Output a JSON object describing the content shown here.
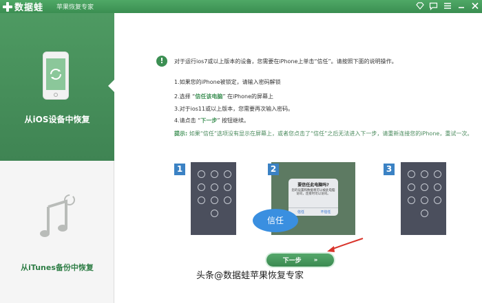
{
  "titlebar": {
    "app_name": "数据蛙",
    "subtitle": "苹果恢复专家",
    "icons": [
      "diamond-icon",
      "chat-icon",
      "menu-icon",
      "minimize-icon",
      "close-icon"
    ]
  },
  "sidebar": {
    "items": [
      {
        "label": "从iOS设备中恢复",
        "icon": "phone-refresh-icon",
        "active": true
      },
      {
        "label": "从iTunes备份中恢复",
        "icon": "music-refresh-icon",
        "active": false
      }
    ]
  },
  "main": {
    "intro": "对于运行ios7或以上版本的设备，您需要在iPhone上单击“信任”。请按照下面的说明操作。",
    "steps": [
      {
        "prefix": "1.如果您的iPhone被锁定，请输入密码解锁",
        "highlight": "",
        "suffix": ""
      },
      {
        "prefix": "2.选择 “",
        "highlight": "信任该电脑",
        "suffix": "” 在iPhone的屏幕上"
      },
      {
        "prefix": "3.对于ios11或以上版本，您需要再次输入密码。",
        "highlight": "",
        "suffix": ""
      },
      {
        "prefix": "4.请点击 “",
        "highlight": "下一步",
        "suffix": "” 按钮继续。"
      }
    ],
    "tip_label": "提示:",
    "tip_text": " 如果“信任”选项没有显示在屏幕上，或者您点击了“信任”之后无法进入下一步，请重新连接您的iPhone，重试一次。",
    "screens": [
      {
        "number": "1"
      },
      {
        "number": "2",
        "dialog_title": "要信任此电脑吗?",
        "dialog_body": "您的设置和数据将可以被此电脑访问，连接时可以访问。",
        "dialog_left": "信任",
        "dialog_right": "不信任"
      },
      {
        "number": "3"
      }
    ],
    "trust_bubble": "信任",
    "next_button": "下一步",
    "next_arrows": "»"
  },
  "watermark": {
    "prefix": "头条",
    "at": "@",
    "name": "数据蛙苹果恢复专家"
  },
  "colors": {
    "brand_green": "#3c8f53",
    "accent_blue": "#3a8fe0",
    "badge_blue": "#3b82c4",
    "arrow_red": "#d9342b"
  }
}
